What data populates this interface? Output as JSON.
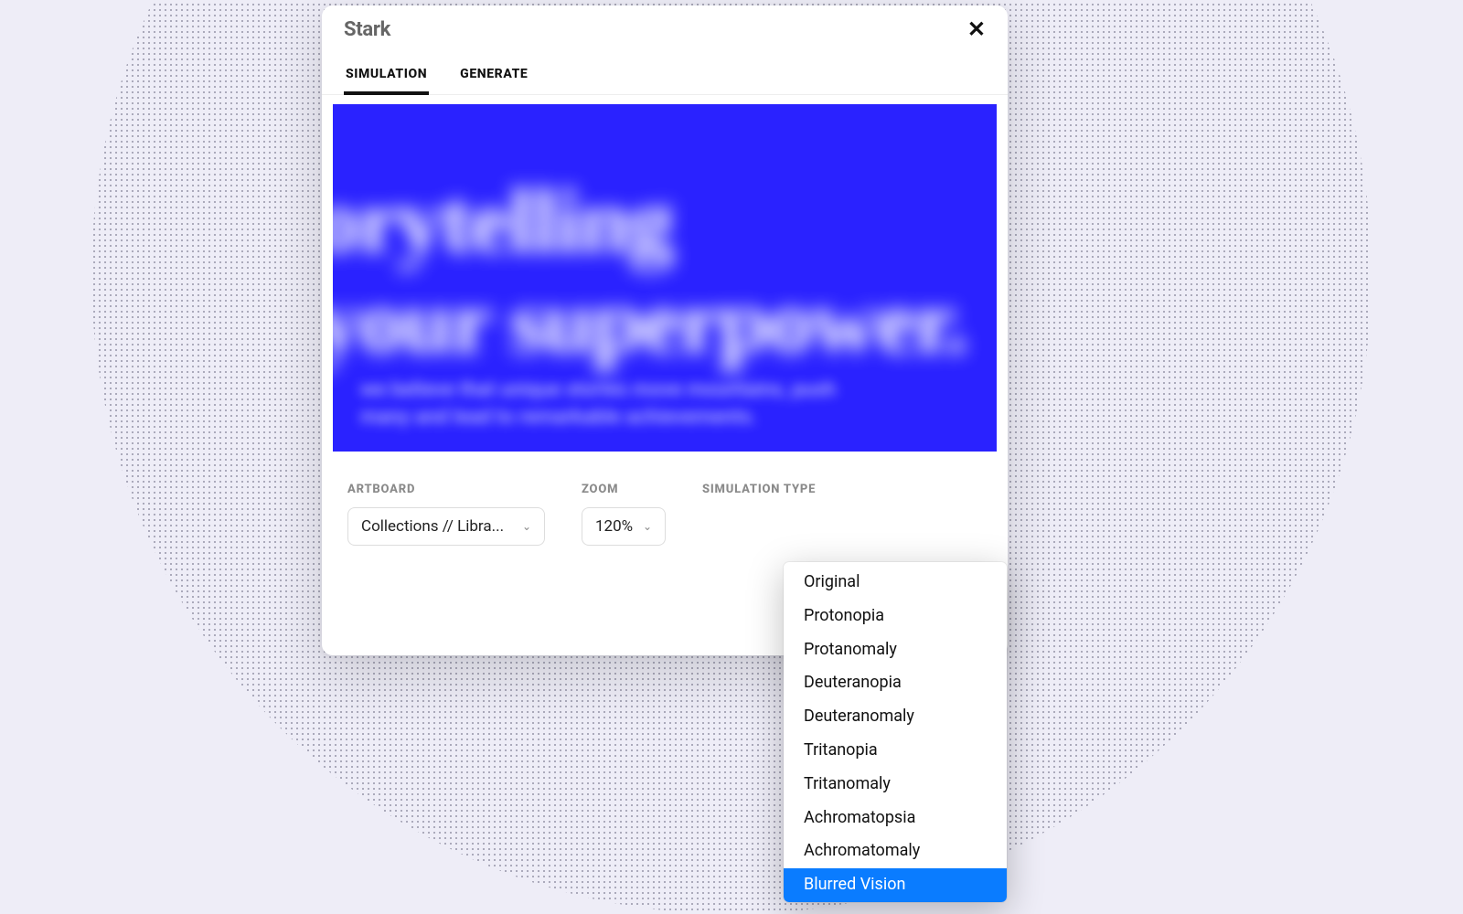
{
  "panel": {
    "title": "Stark",
    "tabs": [
      {
        "label": "SIMULATION",
        "active": true
      },
      {
        "label": "GENERATE",
        "active": false
      }
    ],
    "preview": {
      "line1": "orytelling",
      "line2": "your superpower.",
      "sub1": "we believe that unique stories move mountains, push",
      "sub2": "many and lead to remarkable achievements."
    },
    "controls": {
      "artboard": {
        "label": "ARTBOARD",
        "value": "Collections // Libra..."
      },
      "zoom": {
        "label": "ZOOM",
        "value": "120%"
      },
      "simtype": {
        "label": "SIMULATION TYPE"
      }
    }
  },
  "dropdown": {
    "options": [
      "Original",
      "Protonopia",
      "Protanomaly",
      "Deuteranopia",
      "Deuteranomaly",
      "Tritanopia",
      "Tritanomaly",
      "Achromatopsia",
      "Achromatomaly",
      "Blurred Vision"
    ],
    "selected": "Blurred Vision"
  }
}
